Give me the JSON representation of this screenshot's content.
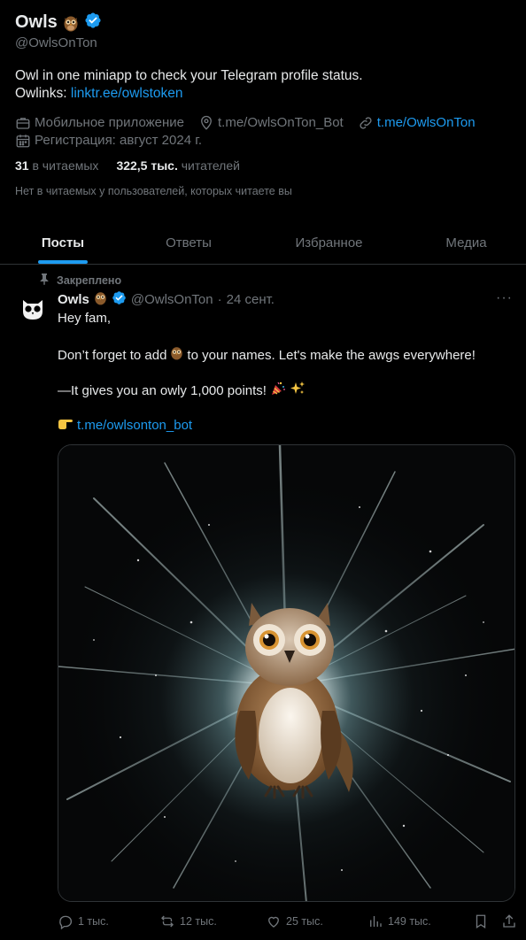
{
  "profile": {
    "name": "Owls",
    "handle": "@OwlsOnTon",
    "bio_line1": "Owl in one miniapp to check your Telegram profile status.",
    "bio_line2_prefix": "Owlinks: ",
    "bio_link": "linktr.ee/owlstoken",
    "category": "Мобильное приложение",
    "location": "t.me/OwlsOnTon_Bot",
    "website": "t.me/OwlsOnTon",
    "joined": "Регистрация: август 2024 г.",
    "following_count": "31",
    "following_label": "в читаемых",
    "followers_count": "322,5 тыс.",
    "followers_label": "читателей",
    "mutual_text": "Нет в читаемых у пользователей, которых читаете вы"
  },
  "tabs": [
    {
      "label": "Посты",
      "active": true
    },
    {
      "label": "Ответы",
      "active": false
    },
    {
      "label": "Избранное",
      "active": false
    },
    {
      "label": "Медиа",
      "active": false
    }
  ],
  "post": {
    "pinned_label": "Закреплено",
    "author": "Owls",
    "handle": "@OwlsOnTon",
    "separator": "·",
    "date": "24 сент.",
    "more": "···",
    "line1": "Hey fam,",
    "line2a": "Don’t forget to add",
    "line2b": "to your names. Let's make the awgs everywhere!",
    "line3": "—It gives you an owly 1,000 points!",
    "line4_link": "t.me/owlsonton_bot",
    "replies": "1 тыс.",
    "reposts": "12 тыс.",
    "likes": "25 тыс.",
    "views": "149 тыс."
  },
  "colors": {
    "accent": "#1d9bf0",
    "muted": "#71767b",
    "text": "#e7e9ea",
    "divider": "#2f3336"
  },
  "icons": [
    "verified-badge-icon",
    "briefcase-icon",
    "location-icon",
    "link-icon",
    "calendar-icon",
    "pin-icon",
    "reply-icon",
    "repost-icon",
    "like-icon",
    "views-icon",
    "bookmark-icon",
    "share-icon",
    "owl-emoji",
    "party-popper-emoji",
    "sparkles-emoji",
    "pointing-hand-emoji"
  ]
}
